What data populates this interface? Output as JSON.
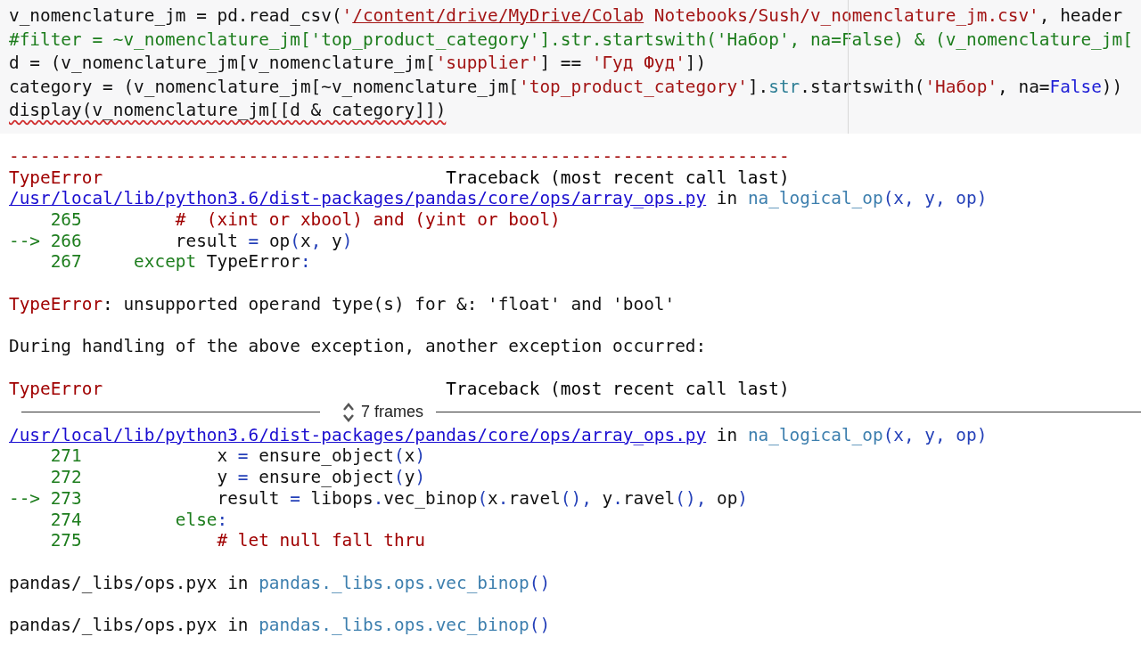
{
  "code_cell": {
    "lines": [
      {
        "squiggle": false,
        "tokens": [
          {
            "kind": "plain",
            "text": "v_nomenclature_jm = pd.read_csv("
          },
          {
            "kind": "string",
            "text": "'"
          },
          {
            "kind": "string_underlined",
            "text": "/content/drive/MyDrive/Colab"
          },
          {
            "kind": "string",
            "text": " Notebooks/Sush/v_nomenclature_jm.csv'"
          },
          {
            "kind": "plain",
            "text": ", header"
          }
        ]
      },
      {
        "squiggle": false,
        "tokens": [
          {
            "kind": "comment",
            "text": "#filter = ~v_nomenclature_jm['top_product_category'].str.startswith('Набор', na=False) & (v_nomenclature_jm["
          }
        ]
      },
      {
        "squiggle": false,
        "tokens": [
          {
            "kind": "plain",
            "text": "d = (v_nomenclature_jm[v_nomenclature_jm["
          },
          {
            "kind": "string",
            "text": "'supplier'"
          },
          {
            "kind": "plain",
            "text": "] == "
          },
          {
            "kind": "string",
            "text": "'Гуд Фуд'"
          },
          {
            "kind": "plain",
            "text": "])"
          }
        ]
      },
      {
        "squiggle": false,
        "tokens": [
          {
            "kind": "plain",
            "text": "category = (v_nomenclature_jm[~v_nomenclature_jm["
          },
          {
            "kind": "string",
            "text": "'top_product_category'"
          },
          {
            "kind": "plain",
            "text": "]."
          },
          {
            "kind": "builtin",
            "text": "str"
          },
          {
            "kind": "plain",
            "text": ".startswith("
          },
          {
            "kind": "string",
            "text": "'Набор'"
          },
          {
            "kind": "plain",
            "text": ", na="
          },
          {
            "kind": "constant",
            "text": "False"
          },
          {
            "kind": "plain",
            "text": "))"
          }
        ]
      },
      {
        "squiggle": true,
        "tokens": [
          {
            "kind": "plain",
            "text": "display(v_nomenclature_jm[[d & category]])"
          }
        ]
      }
    ]
  },
  "output": [
    {
      "kind": "line",
      "tokens": [
        {
          "kind": "error",
          "text": "---------------------------------------------------------------------------"
        }
      ]
    },
    {
      "kind": "header",
      "error": "TypeError",
      "traceback": "Traceback (most recent call last)"
    },
    {
      "kind": "line",
      "tokens": [
        {
          "kind": "link",
          "text": "/usr/local/lib/python3.6/dist-packages/pandas/core/ops/array_ops.py"
        },
        {
          "kind": "plain",
          "text": " in "
        },
        {
          "kind": "function",
          "text": "na_logical_op"
        },
        {
          "kind": "operator",
          "text": "(x, y, op)"
        }
      ]
    },
    {
      "kind": "line",
      "tokens": [
        {
          "kind": "lineno",
          "text": "    265"
        },
        {
          "kind": "comment_red",
          "text": "         #  (xint or xbool) and (yint or bool)"
        }
      ]
    },
    {
      "kind": "line",
      "tokens": [
        {
          "kind": "lineno",
          "text": "--> 266"
        },
        {
          "kind": "plain",
          "text": "         result "
        },
        {
          "kind": "operator",
          "text": "="
        },
        {
          "kind": "plain",
          "text": " op"
        },
        {
          "kind": "operator",
          "text": "("
        },
        {
          "kind": "plain",
          "text": "x"
        },
        {
          "kind": "operator",
          "text": ","
        },
        {
          "kind": "plain",
          "text": " y"
        },
        {
          "kind": "operator",
          "text": ")"
        }
      ]
    },
    {
      "kind": "line",
      "tokens": [
        {
          "kind": "lineno",
          "text": "    267"
        },
        {
          "kind": "keyword",
          "text": "     except"
        },
        {
          "kind": "plain",
          "text": " TypeError"
        },
        {
          "kind": "operator",
          "text": ":"
        }
      ]
    },
    {
      "kind": "blank"
    },
    {
      "kind": "line",
      "tokens": [
        {
          "kind": "error",
          "text": "TypeError"
        },
        {
          "kind": "plain",
          "text": ": unsupported operand type(s) for &: 'float' and 'bool'"
        }
      ]
    },
    {
      "kind": "blank"
    },
    {
      "kind": "line",
      "tokens": [
        {
          "kind": "plain",
          "text": "During handling of the above exception, another exception occurred:"
        }
      ]
    },
    {
      "kind": "blank"
    },
    {
      "kind": "header",
      "error": "TypeError",
      "traceback": "Traceback (most recent call last)"
    },
    {
      "kind": "frames",
      "label": "7 frames"
    },
    {
      "kind": "line",
      "tokens": [
        {
          "kind": "link",
          "text": "/usr/local/lib/python3.6/dist-packages/pandas/core/ops/array_ops.py"
        },
        {
          "kind": "plain",
          "text": " in "
        },
        {
          "kind": "function",
          "text": "na_logical_op"
        },
        {
          "kind": "operator",
          "text": "(x, y, op)"
        }
      ]
    },
    {
      "kind": "line",
      "tokens": [
        {
          "kind": "lineno",
          "text": "    271"
        },
        {
          "kind": "plain",
          "text": "             x "
        },
        {
          "kind": "operator",
          "text": "="
        },
        {
          "kind": "plain",
          "text": " ensure_object"
        },
        {
          "kind": "operator",
          "text": "("
        },
        {
          "kind": "plain",
          "text": "x"
        },
        {
          "kind": "operator",
          "text": ")"
        }
      ]
    },
    {
      "kind": "line",
      "tokens": [
        {
          "kind": "lineno",
          "text": "    272"
        },
        {
          "kind": "plain",
          "text": "             y "
        },
        {
          "kind": "operator",
          "text": "="
        },
        {
          "kind": "plain",
          "text": " ensure_object"
        },
        {
          "kind": "operator",
          "text": "("
        },
        {
          "kind": "plain",
          "text": "y"
        },
        {
          "kind": "operator",
          "text": ")"
        }
      ]
    },
    {
      "kind": "line",
      "tokens": [
        {
          "kind": "lineno",
          "text": "--> 273"
        },
        {
          "kind": "plain",
          "text": "             result "
        },
        {
          "kind": "operator",
          "text": "="
        },
        {
          "kind": "plain",
          "text": " libops"
        },
        {
          "kind": "operator",
          "text": "."
        },
        {
          "kind": "plain",
          "text": "vec_binop"
        },
        {
          "kind": "operator",
          "text": "("
        },
        {
          "kind": "plain",
          "text": "x"
        },
        {
          "kind": "operator",
          "text": "."
        },
        {
          "kind": "plain",
          "text": "ravel"
        },
        {
          "kind": "operator",
          "text": "(),"
        },
        {
          "kind": "plain",
          "text": " y"
        },
        {
          "kind": "operator",
          "text": "."
        },
        {
          "kind": "plain",
          "text": "ravel"
        },
        {
          "kind": "operator",
          "text": "(),"
        },
        {
          "kind": "plain",
          "text": " op"
        },
        {
          "kind": "operator",
          "text": ")"
        }
      ]
    },
    {
      "kind": "line",
      "tokens": [
        {
          "kind": "lineno",
          "text": "    274"
        },
        {
          "kind": "keyword",
          "text": "         else"
        },
        {
          "kind": "operator",
          "text": ":"
        }
      ]
    },
    {
      "kind": "line",
      "tokens": [
        {
          "kind": "lineno",
          "text": "    275"
        },
        {
          "kind": "comment_red",
          "text": "             # let null fall thru"
        }
      ]
    },
    {
      "kind": "blank"
    },
    {
      "kind": "line",
      "tokens": [
        {
          "kind": "plain",
          "text": "pandas/_libs/ops.pyx in "
        },
        {
          "kind": "function",
          "text": "pandas._libs.ops.vec_binop"
        },
        {
          "kind": "operator",
          "text": "()"
        }
      ]
    },
    {
      "kind": "blank"
    },
    {
      "kind": "line",
      "tokens": [
        {
          "kind": "plain",
          "text": "pandas/_libs/ops.pyx in "
        },
        {
          "kind": "function",
          "text": "pandas._libs.ops.vec_binop"
        },
        {
          "kind": "operator",
          "text": "()"
        }
      ]
    }
  ]
}
